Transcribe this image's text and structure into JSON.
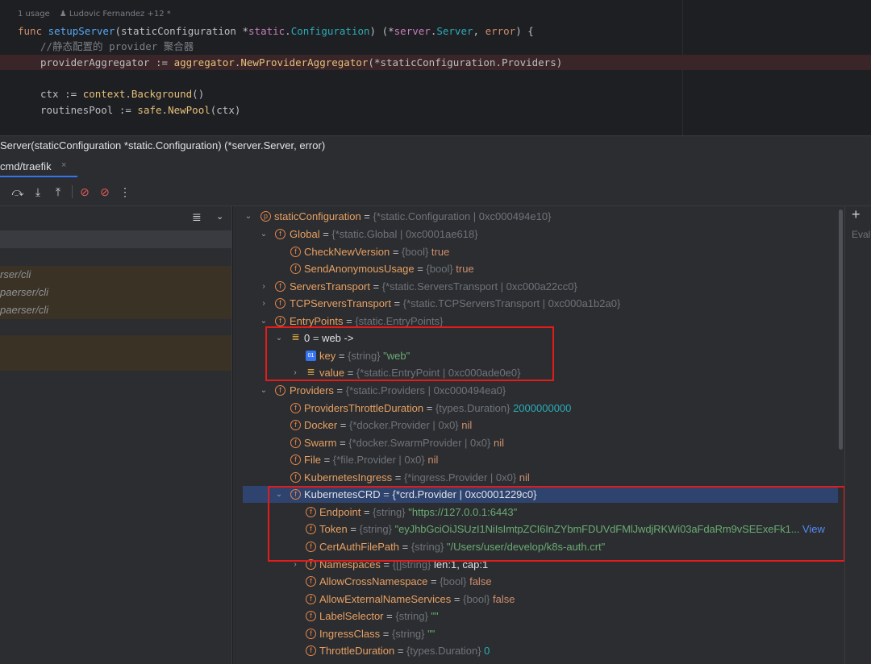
{
  "editor": {
    "meta": {
      "usages": "1 usage",
      "author": "♟ Ludovic Fernandez +12 *"
    },
    "lines": {
      "l1": {
        "kw_func": "func ",
        "name": "setupServer",
        "p1": "(staticConfiguration *",
        "pk": "static",
        "p2": ".",
        "ty": "Configuration",
        "p3": ") (*",
        "pk2": "server",
        "p4": ".",
        "ty2": "Server",
        "p5": ", ",
        "ret": "error",
        "p6": ") {"
      },
      "l2": {
        "comment": "//静态配置的 provider 聚合器"
      },
      "l3": {
        "a": "providerAggregator := ",
        "pk": "aggregator",
        "b": ".",
        "call": "NewProviderAggregator",
        "c": "(*staticConfiguration.Providers)"
      },
      "l4": {
        "a": "ctx := ",
        "pk": "context",
        "b": ".",
        "call": "Background",
        "c": "()"
      },
      "l5": {
        "a": "routinesPool := ",
        "pk": "safe",
        "b": ".",
        "call": "NewPool",
        "c": "(ctx)"
      }
    }
  },
  "breadcrumb": "Server(staticConfiguration *static.Configuration) (*server.Server, error)",
  "tabs": [
    {
      "label": "cmd/traefik",
      "close": "×"
    }
  ],
  "toolbar": {
    "icons": [
      "step-over-icon",
      "step-into-icon",
      "step-out-icon",
      "view-breakpoints-icon",
      "mute-breakpoints-icon",
      "more-icon"
    ],
    "glyphs": {
      "step_over": "⤼",
      "step_into": "⤓",
      "step_out": "⤒",
      "breakpoints": "⊘",
      "mute": "⊘",
      "more": "⋮"
    }
  },
  "frames": {
    "menu_glyph": "≣",
    "chev_glyph": "⌄",
    "items": [
      "rser/cli",
      "paerser/cli",
      "paerser/cli"
    ]
  },
  "variables": {
    "r0": {
      "name": "staticConfiguration",
      "eq": " = ",
      "type": "{*static.Configuration | 0xc000494e10}"
    },
    "r1": {
      "name": "Global",
      "eq": " = ",
      "type": "{*static.Global | 0xc0001ae618}"
    },
    "r2": {
      "name": "CheckNewVersion",
      "eq": " = ",
      "type": "{bool} ",
      "value": "true"
    },
    "r3": {
      "name": "SendAnonymousUsage",
      "eq": " = ",
      "type": "{bool} ",
      "value": "true"
    },
    "r4": {
      "name": "ServersTransport",
      "eq": " = ",
      "type": "{*static.ServersTransport | 0xc000a22cc0}"
    },
    "r5": {
      "name": "TCPServersTransport",
      "eq": " = ",
      "type": "{*static.TCPServersTransport | 0xc000a1b2a0}"
    },
    "r6": {
      "name": "EntryPoints",
      "eq": " = ",
      "type": "{static.EntryPoints}"
    },
    "r7": {
      "name": "0",
      "eq": " = ",
      "value": "web ->"
    },
    "r8": {
      "name": "key",
      "eq": " = ",
      "type": "{string} ",
      "value": "\"web\""
    },
    "r9": {
      "name": "value",
      "eq": " = ",
      "type": "{*static.EntryPoint | 0xc000ade0e0}"
    },
    "r10": {
      "name": "Providers",
      "eq": " = ",
      "type": "{*static.Providers | 0xc000494ea0}"
    },
    "r11": {
      "name": "ProvidersThrottleDuration",
      "eq": " = ",
      "type": "{types.Duration} ",
      "value": "2000000000"
    },
    "r12": {
      "name": "Docker",
      "eq": " = ",
      "type": "{*docker.Provider | 0x0} ",
      "value": "nil"
    },
    "r13": {
      "name": "Swarm",
      "eq": " = ",
      "type": "{*docker.SwarmProvider | 0x0} ",
      "value": "nil"
    },
    "r14": {
      "name": "File",
      "eq": " = ",
      "type": "{*file.Provider | 0x0} ",
      "value": "nil"
    },
    "r15": {
      "name": "KubernetesIngress",
      "eq": " = ",
      "type": "{*ingress.Provider | 0x0} ",
      "value": "nil"
    },
    "r16": {
      "name": "KubernetesCRD",
      "eq": " = ",
      "value": "{*crd.Provider | 0xc0001229c0}"
    },
    "r17": {
      "name": "Endpoint",
      "eq": " = ",
      "type": "{string} ",
      "value": "\"https://127.0.0.1:6443\""
    },
    "r18": {
      "name": "Token",
      "eq": " = ",
      "type": "{string} ",
      "value": "\"eyJhbGciOiJSUzI1NiIsImtpZCI6InZYbmFDUVdFMlJwdjRKWi03aFdaRm9vSEExeFk1...",
      "link": "View"
    },
    "r19": {
      "name": "CertAuthFilePath",
      "eq": " = ",
      "type": "{string} ",
      "value": "\"/Users/user/develop/k8s-auth.crt\""
    },
    "r20": {
      "name": "Namespaces",
      "eq": " = ",
      "type": "{[]string} ",
      "value": "len:1, cap:1"
    },
    "r21": {
      "name": "AllowCrossNamespace",
      "eq": " = ",
      "type": "{bool} ",
      "value": "false"
    },
    "r22": {
      "name": "AllowExternalNameServices",
      "eq": " = ",
      "type": "{bool} ",
      "value": "false"
    },
    "r23": {
      "name": "LabelSelector",
      "eq": " = ",
      "type": "{string} ",
      "value": "\"\""
    },
    "r24": {
      "name": "IngressClass",
      "eq": " = ",
      "type": "{string} ",
      "value": "\"\""
    },
    "r25": {
      "name": "ThrottleDuration",
      "eq": " = ",
      "type": "{types.Duration} ",
      "value": "0"
    }
  },
  "right": {
    "plus": "+",
    "eval": "Eval"
  },
  "glyphs": {
    "expanded": "⌄",
    "collapsed": "›",
    "field": "f",
    "param": "p",
    "key_badge": "01",
    "list": "≣"
  },
  "colors": {
    "accent": "#3574f0",
    "highlight_box": "#e31b1b",
    "selected_row": "#2e436e"
  }
}
